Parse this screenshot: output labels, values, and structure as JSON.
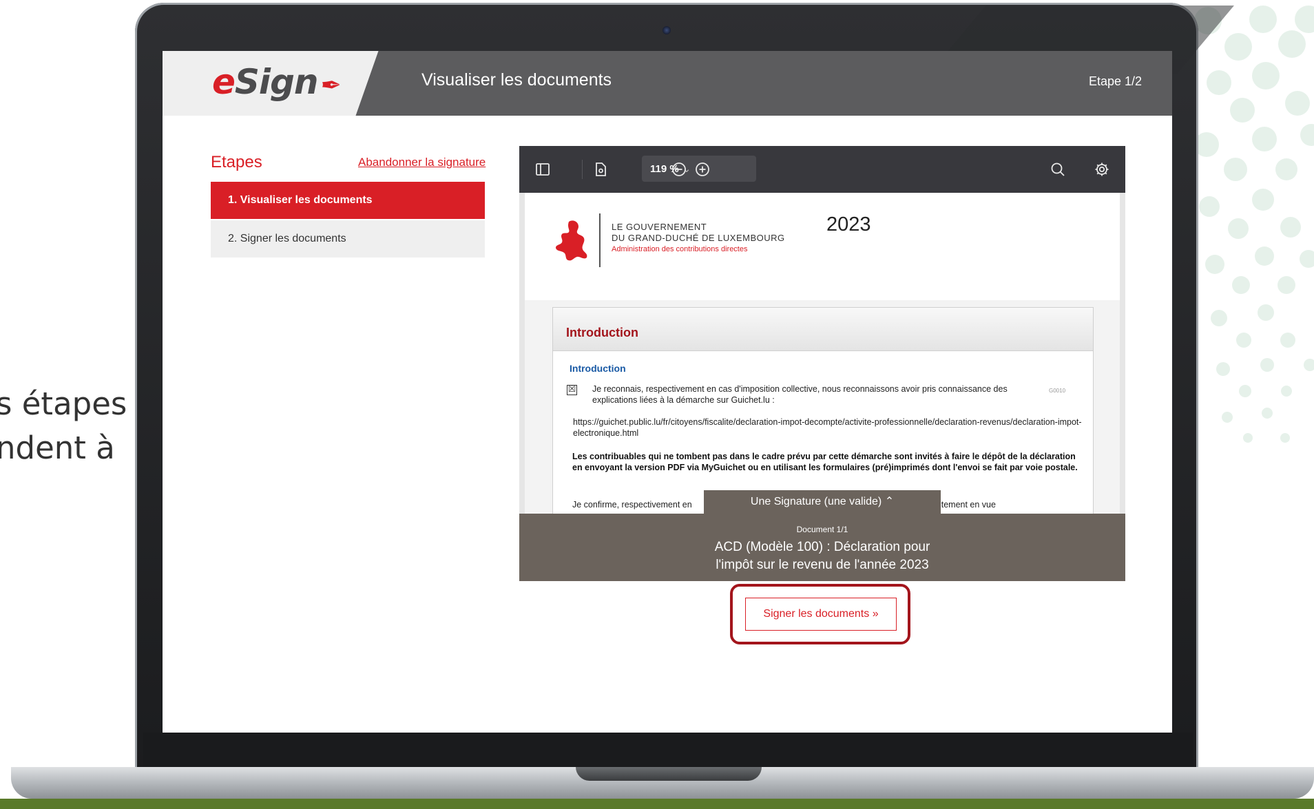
{
  "side_text": {
    "line1": "s étapes",
    "line2": "ndent à"
  },
  "header": {
    "title": "Visualiser les documents",
    "step": "Etape 1/2"
  },
  "logo": {
    "e": "e",
    "rest": "Sign"
  },
  "steps": {
    "title": "Etapes",
    "abandon_label": "Abandonner la signature",
    "items": [
      {
        "label": "1. Visualiser les documents",
        "active": true
      },
      {
        "label": "2. Signer les documents",
        "active": false
      }
    ]
  },
  "viewer": {
    "zoom": "119 %",
    "page": {
      "gov_line1": "LE GOUVERNEMENT",
      "gov_line2": "DU GRAND-DUCHÉ DE LUXEMBOURG",
      "gov_sub": "Administration des contributions directes",
      "year": "2023",
      "section_title": "Introduction",
      "subsection": "Introduction",
      "checkbox_mark": "☒",
      "p1": "Je reconnais, respectivement en cas d'imposition collective, nous reconnaissons avoir pris connaissance des explications liées à la démarche sur Guichet.lu :",
      "code": "G0010",
      "p2": "https://guichet.public.lu/fr/citoyens/fiscalite/declaration-impot-decompte/activite-professionnelle/declaration-revenus/declaration-impot-electronique.html",
      "p3": "Les contribuables qui ne tombent pas dans le cadre prévu par cette démarche sont invités à faire le dépôt de la déclaration en envoyant la version PDF via MyGuichet ou en utilisant les formulaires (pré)imprimés dont l'envoi se fait par voie postale.",
      "p4_left": "Je confirme, respectivement en",
      "p4_right": "/notre consentement en vue"
    },
    "signature_tab": "Une Signature (une valide)  ⌃",
    "doc_number": "Document 1/1",
    "doc_title_line1": "ACD (Modèle 100) : Déclaration pour",
    "doc_title_line2": "l'impôt sur le revenu de l'année 2023"
  },
  "sign_button": "Signer les documents  »",
  "colors": {
    "accent": "#d91f26",
    "header_bg": "#5c5c5e",
    "panel_bg": "#6b635c"
  }
}
